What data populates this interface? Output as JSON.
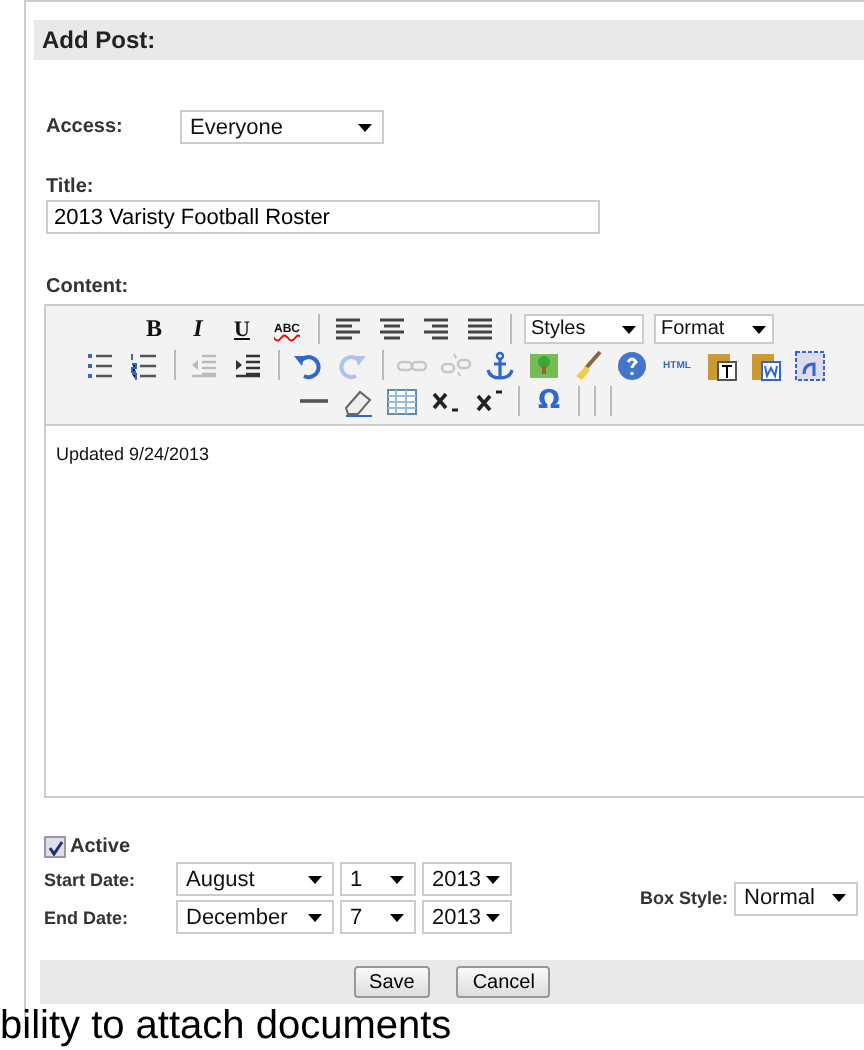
{
  "panel": {
    "title": "Add Post:"
  },
  "access": {
    "label": "Access:",
    "value": "Everyone"
  },
  "title_field": {
    "label": "Title:",
    "value": "2013 Varisty Football Roster"
  },
  "content": {
    "label": "Content:",
    "body": "Updated 9/24/2013",
    "toolbar": [
      [
        {
          "kind": "bold",
          "glyph": "B",
          "disabled": false
        },
        {
          "kind": "italic",
          "glyph": "I",
          "disabled": false
        },
        {
          "kind": "underline",
          "glyph": "U",
          "disabled": false
        },
        {
          "kind": "spell",
          "glyph": "ABC",
          "disabled": false
        },
        {
          "kind": "sep"
        },
        {
          "kind": "align-left",
          "disabled": false
        },
        {
          "kind": "align-center",
          "disabled": false
        },
        {
          "kind": "align-right",
          "disabled": false
        },
        {
          "kind": "justify",
          "disabled": false
        },
        {
          "kind": "sep"
        },
        {
          "kind": "dropdown",
          "value": "Styles"
        },
        {
          "kind": "dropdown",
          "value": "Format"
        }
      ],
      [
        {
          "kind": "bullet-list",
          "disabled": false
        },
        {
          "kind": "numbered-list",
          "disabled": false
        },
        {
          "kind": "sep"
        },
        {
          "kind": "outdent",
          "disabled": true
        },
        {
          "kind": "indent",
          "disabled": false
        },
        {
          "kind": "sep"
        },
        {
          "kind": "undo",
          "disabled": false
        },
        {
          "kind": "redo",
          "disabled": true
        },
        {
          "kind": "sep"
        },
        {
          "kind": "link",
          "disabled": true
        },
        {
          "kind": "unlink",
          "disabled": true
        },
        {
          "kind": "anchor",
          "disabled": false
        },
        {
          "kind": "image",
          "disabled": false
        },
        {
          "kind": "brush",
          "disabled": false
        },
        {
          "kind": "help",
          "disabled": false
        },
        {
          "kind": "html",
          "glyph": "HTML",
          "disabled": false
        },
        {
          "kind": "paste-text",
          "disabled": false
        },
        {
          "kind": "paste-word",
          "disabled": false
        },
        {
          "kind": "select-all",
          "disabled": false
        }
      ],
      [
        {
          "kind": "hr",
          "disabled": false
        },
        {
          "kind": "eraser",
          "disabled": false
        },
        {
          "kind": "table",
          "disabled": false
        },
        {
          "kind": "subscript",
          "disabled": false
        },
        {
          "kind": "superscript",
          "disabled": false
        },
        {
          "kind": "sep"
        },
        {
          "kind": "omega",
          "glyph": "Ω",
          "disabled": false
        },
        {
          "kind": "sep"
        },
        {
          "kind": "sep"
        },
        {
          "kind": "sep"
        }
      ]
    ]
  },
  "active": {
    "label": "Active",
    "checked": true
  },
  "dates": [
    {
      "label": "Start Date:",
      "month": "August",
      "day": "1",
      "year": "2013"
    },
    {
      "label": "End Date:",
      "month": "December",
      "day": "7",
      "year": "2013"
    }
  ],
  "box_style": {
    "label": "Box Style:",
    "value": "Normal"
  },
  "buttons": [
    "Save",
    "Cancel"
  ],
  "caption": "bility to attach documents"
}
